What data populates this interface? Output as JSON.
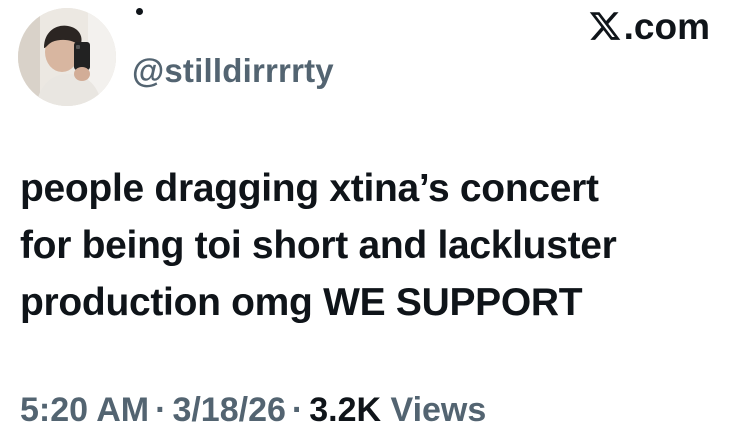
{
  "source": {
    "label": ".com",
    "logo_icon": "x-logo-icon"
  },
  "author": {
    "handle": "@stilldirrrrty",
    "avatar_icon": "avatar-photo"
  },
  "tweet": {
    "lines": [
      "people dragging xtina’s concert",
      "for being toi short and lackluster",
      "production omg WE SUPPORT"
    ]
  },
  "meta": {
    "time": "5:20 AM",
    "separator": "·",
    "date": "3/18/26",
    "views_count": "3.2K",
    "views_label": "Views"
  },
  "colors": {
    "text_primary": "#0f1419",
    "text_secondary": "#536471",
    "background": "#ffffff"
  }
}
